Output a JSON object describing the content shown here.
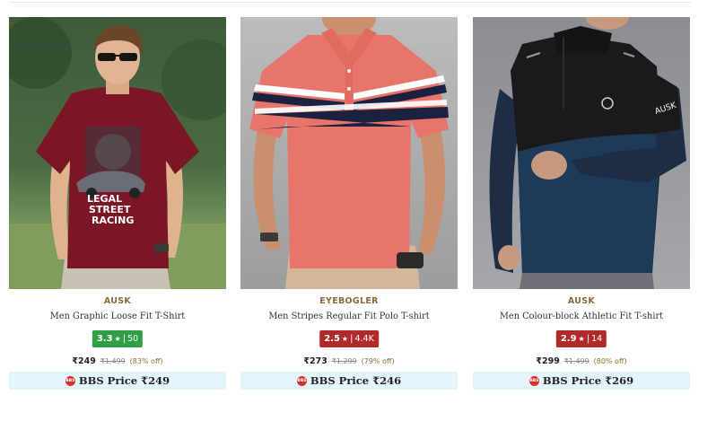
{
  "products": [
    {
      "brand": "AUSK",
      "title": "Men Graphic Loose Fit T-Shirt",
      "rating": "3.3",
      "rating_count": "50",
      "rating_color": "#2f9e44",
      "price": "₹249",
      "mrp": "₹1,499",
      "discount": "(83% off)",
      "bbs_label": "BBS Price ₹249",
      "print_text": [
        "LEGAL",
        "STREET",
        "RACING"
      ]
    },
    {
      "brand": "EYEBOGLER",
      "title": "Men Stripes Regular Fit Polo T-shirt",
      "rating": "2.5",
      "rating_count": "4.4K",
      "rating_color": "#b02a2a",
      "price": "₹273",
      "mrp": "₹1,299",
      "discount": "(79% off)",
      "bbs_label": "BBS Price ₹246"
    },
    {
      "brand": "AUSK",
      "title": "Men Colour-block Athletic Fit T-shirt",
      "rating": "2.9",
      "rating_count": "14",
      "rating_color": "#b02a2a",
      "price": "₹299",
      "mrp": "₹1,499",
      "discount": "(80% off)",
      "bbs_label": "BBS Price ₹269",
      "sleeve_text": "AUSK"
    }
  ],
  "icons": {
    "star": "star-icon",
    "bbs_logo": "bbs-logo-icon"
  },
  "bbs_logo_text": "BBS",
  "star_glyph": "★",
  "separator": "|"
}
